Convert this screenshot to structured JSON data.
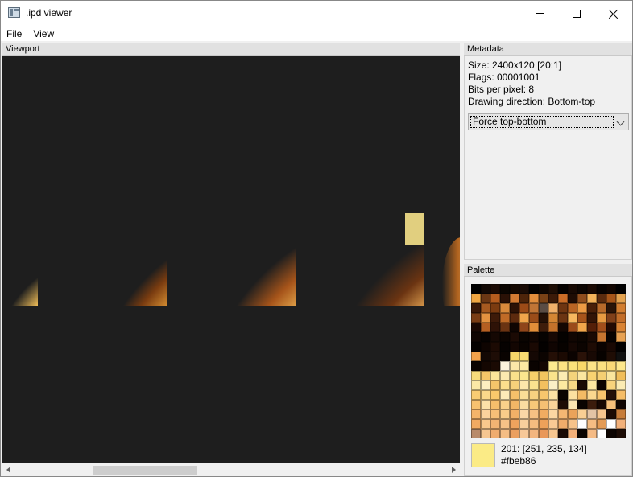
{
  "window": {
    "title": ".ipd viewer",
    "icon": "image-viewer-icon"
  },
  "menu": [
    "File",
    "View"
  ],
  "viewport": {
    "title": "Viewport",
    "background": "#1e1e1e"
  },
  "metadata": {
    "title": "Metadata",
    "size": "Size: 2400x120 [20:1]",
    "flags": "Flags: 00001001",
    "bpp": "Bits per pixel: 8",
    "direction": "Drawing direction: Bottom-top",
    "dropdown_value": "Force top-bottom"
  },
  "palette": {
    "title": "Palette",
    "selected": {
      "label": "201: [251, 235, 134]",
      "hex": "#fbeb86"
    },
    "colors": [
      "#000000",
      "#120905",
      "#1c0b04",
      "#0a0501",
      "#140801",
      "#1a0c06",
      "#030100",
      "#0f0702",
      "#1e0e05",
      "#050200",
      "#170903",
      "#0d0602",
      "#1b0a03",
      "#080301",
      "#110601",
      "#000000",
      "#f0a642",
      "#6a3714",
      "#b55c1e",
      "#2a1106",
      "#d27a32",
      "#4d240a",
      "#e18d3c",
      "#7a4216",
      "#3b1a08",
      "#c96c27",
      "#1e0c04",
      "#8f4d1d",
      "#f4b35a",
      "#5b2b0e",
      "#a65519",
      "#e3a24f",
      "#3a1808",
      "#a65a20",
      "#7b3b10",
      "#d98a3b",
      "#2c1206",
      "#9d4b17",
      "#c07536",
      "#5a4c44",
      "#f0b06a",
      "#6e3511",
      "#ba6524",
      "#ed9b44",
      "#4a2009",
      "#b86a2a",
      "#2a1408",
      "#d17d30",
      "#7a3c14",
      "#e39240",
      "#3d1a09",
      "#c06b27",
      "#5c2a0e",
      "#f0a54b",
      "#9a4c19",
      "#241006",
      "#d48634",
      "#6b3412",
      "#f7b85f",
      "#a7541b",
      "#331507",
      "#e89b42",
      "#80401a",
      "#c26d29",
      "#1b0803",
      "#b45f22",
      "#2e1207",
      "#6a3312",
      "#0f0502",
      "#8f451a",
      "#e38e39",
      "#3e1c0a",
      "#c4722b",
      "#140702",
      "#9c4b1a",
      "#f2a64b",
      "#541f08",
      "#a24e1b",
      "#230a03",
      "#d98334",
      "#100502",
      "#060201",
      "#150803",
      "#0b0401",
      "#1b0a04",
      "#0a0401",
      "#120602",
      "#070301",
      "#180904",
      "#050200",
      "#110602",
      "#0d0501",
      "#1a0a04",
      "#c57530",
      "#080301",
      "#e7a152",
      "#050100",
      "#0e0401",
      "#1c0a03",
      "#060201",
      "#130602",
      "#0a0300",
      "#1a0903",
      "#040100",
      "#100502",
      "#070200",
      "#150703",
      "#0c0401",
      "#1e0b04",
      "#0b0301",
      "#190803",
      "#020000",
      "#f2a24c",
      "#130804",
      "#1e0d06",
      "#090301",
      "#f6d66a",
      "#f8dc72",
      "#150804",
      "#0c0401",
      "#240f06",
      "#1b0a03",
      "#0b0301",
      "#2a1208",
      "#180904",
      "#070200",
      "#1f0d05",
      "#101010",
      "#0c0401",
      "#140702",
      "#1a0a03",
      "#fcf3dd",
      "#fbe7a8",
      "#fde9a2",
      "#0a0301",
      "#130602",
      "#fcea8f",
      "#fde383",
      "#fbe27a",
      "#f9d969",
      "#fce487",
      "#fbe080",
      "#fad977",
      "#fde78c",
      "#f7dc7b",
      "#f5c768",
      "#fbe59a",
      "#fceab0",
      "#f9e18b",
      "#fbe68e",
      "#f6d06a",
      "#f2c55f",
      "#fbe38c",
      "#fcecb2",
      "#f4d47b",
      "#fbe6a0",
      "#f8d271",
      "#f5cf73",
      "#fae59d",
      "#f0bd5a",
      "#fbe9a6",
      "#fdeec0",
      "#f4c56a",
      "#fbdf8c",
      "#f7d17a",
      "#fde6ab",
      "#fbe28f",
      "#f3c05f",
      "#faf0c7",
      "#fce9a0",
      "#f9d984",
      "#1a0a04",
      "#fce7a1",
      "#0c0401",
      "#f8d37c",
      "#fbebb3",
      "#f8cc73",
      "#fad88a",
      "#f9c86b",
      "#fdeab9",
      "#f5c06a",
      "#fbdf96",
      "#f8d180",
      "#f7c66d",
      "#fbe2a5",
      "#0a0401",
      "#fde1a0",
      "#f4bb65",
      "#fbd78f",
      "#f9c46e",
      "#251008",
      "#f5bc66",
      "#f7c170",
      "#fde1a9",
      "#f6be6b",
      "#f9d08a",
      "#f3b666",
      "#fbdca1",
      "#f7c879",
      "#f5bf73",
      "#fad399",
      "#1e0c05",
      "#fbe5b2",
      "#0a0401",
      "#3b1c0c",
      "#170803",
      "#f6c17c",
      "#0f0502",
      "#f4b46a",
      "#fbd39d",
      "#f7bf77",
      "#f9cc8a",
      "#f3b067",
      "#fad7a6",
      "#f6c183",
      "#f1ac61",
      "#fbd6a2",
      "#f4b773",
      "#eaa35a",
      "#f9cf94",
      "#e3c4a5",
      "#f6c58e",
      "#1b0a04",
      "#c67c3a",
      "#f2aa62",
      "#f8c88d",
      "#f3b373",
      "#f6c287",
      "#efa35d",
      "#f8cf9c",
      "#f5bc80",
      "#eda15a",
      "#f9c994",
      "#f0ac6b",
      "#f6c38b",
      "#ffffff",
      "#f5bd83",
      "#e39b55",
      "#ffffff",
      "#f1b07a",
      "#b88a6a",
      "#f6c691",
      "#efac6e",
      "#f4bd84",
      "#eb9f5f",
      "#f7c898",
      "#f2b57f",
      "#e9985a",
      "#f7c690",
      "#1a0904",
      "#f2b07a",
      "#0a0401",
      "#f4bb86",
      "#ffffff",
      "#0d0502",
      "#1c0c05"
    ]
  }
}
